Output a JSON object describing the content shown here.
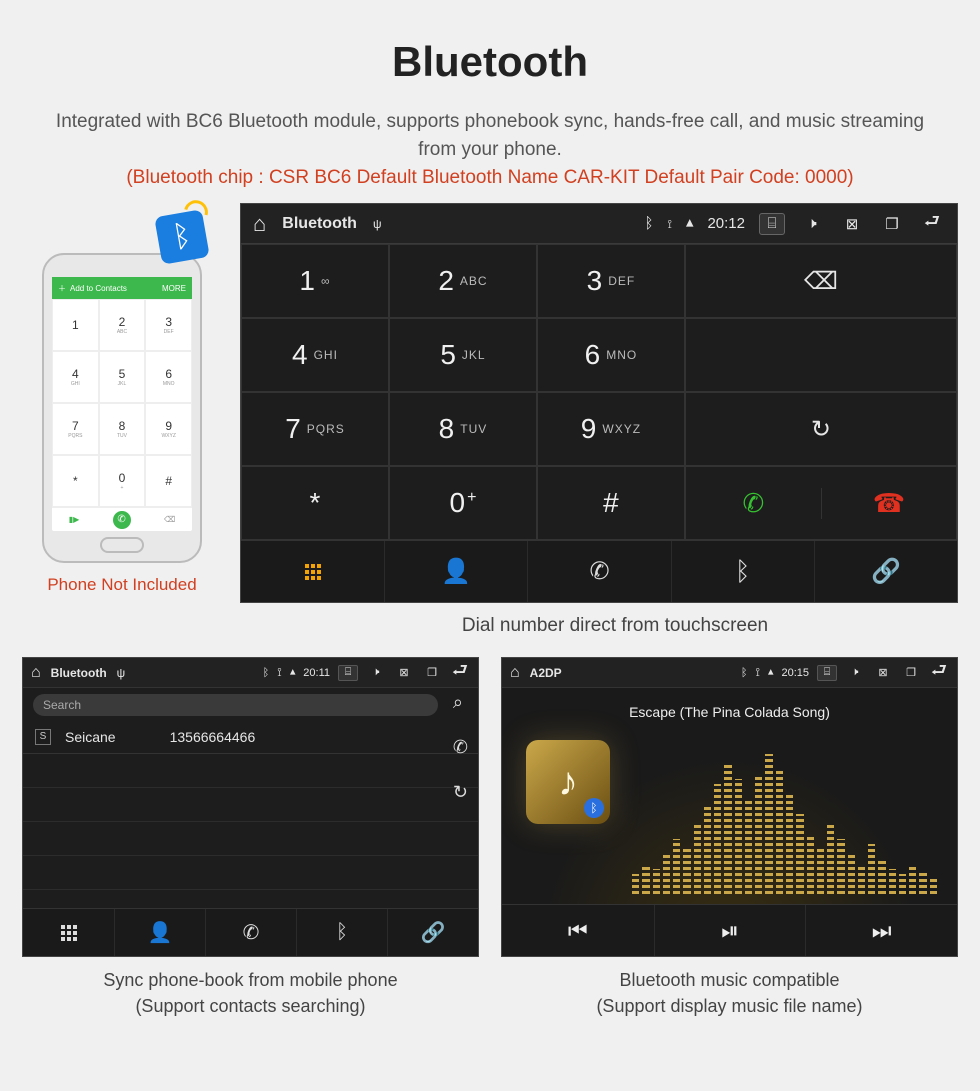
{
  "header": {
    "title": "Bluetooth",
    "subtitle": "Integrated with BC6 Bluetooth module, supports phonebook sync, hands-free call, and music streaming from your phone.",
    "red_line": "(Bluetooth chip : CSR BC6     Default Bluetooth Name CAR-KIT     Default Pair Code: 0000)"
  },
  "phone_mock": {
    "top_bar_label": "Add to Contacts",
    "top_bar_right": "MORE",
    "keys": [
      {
        "n": "1",
        "s": ""
      },
      {
        "n": "2",
        "s": "ABC"
      },
      {
        "n": "3",
        "s": "DEF"
      },
      {
        "n": "4",
        "s": "GHI"
      },
      {
        "n": "5",
        "s": "JKL"
      },
      {
        "n": "6",
        "s": "MNO"
      },
      {
        "n": "7",
        "s": "PQRS"
      },
      {
        "n": "8",
        "s": "TUV"
      },
      {
        "n": "9",
        "s": "WXYZ"
      },
      {
        "n": "*",
        "s": ""
      },
      {
        "n": "0",
        "s": "+"
      },
      {
        "n": "#",
        "s": ""
      }
    ],
    "note": "Phone Not Included"
  },
  "dialer_panel": {
    "status": {
      "title": "Bluetooth",
      "time": "20:12"
    },
    "keys": [
      {
        "n": "1",
        "s": "∞"
      },
      {
        "n": "2",
        "s": "ABC"
      },
      {
        "n": "3",
        "s": "DEF"
      },
      {
        "n": "4",
        "s": "GHI"
      },
      {
        "n": "5",
        "s": "JKL"
      },
      {
        "n": "6",
        "s": "MNO"
      },
      {
        "n": "7",
        "s": "PQRS"
      },
      {
        "n": "8",
        "s": "TUV"
      },
      {
        "n": "9",
        "s": "WXYZ"
      },
      {
        "n": "*",
        "s": ""
      },
      {
        "n": "0",
        "s": "+"
      },
      {
        "n": "#",
        "s": ""
      }
    ],
    "caption": "Dial number direct from touchscreen"
  },
  "phonebook_panel": {
    "status": {
      "title": "Bluetooth",
      "time": "20:11"
    },
    "search_placeholder": "Search",
    "contact_tag": "S",
    "contact_name": "Seicane",
    "contact_number": "13566664466",
    "caption_l1": "Sync phone-book from mobile phone",
    "caption_l2": "(Support contacts searching)"
  },
  "music_panel": {
    "status": {
      "title": "A2DP",
      "time": "20:15"
    },
    "track_title": "Escape (The Pina Colada Song)",
    "eq_heights": [
      20,
      30,
      25,
      40,
      55,
      48,
      70,
      90,
      110,
      130,
      115,
      95,
      120,
      140,
      125,
      100,
      80,
      60,
      45,
      70,
      55,
      40,
      30,
      50,
      35,
      25,
      20,
      30,
      22,
      18
    ],
    "caption_l1": "Bluetooth music compatible",
    "caption_l2": "(Support display music file name)"
  }
}
